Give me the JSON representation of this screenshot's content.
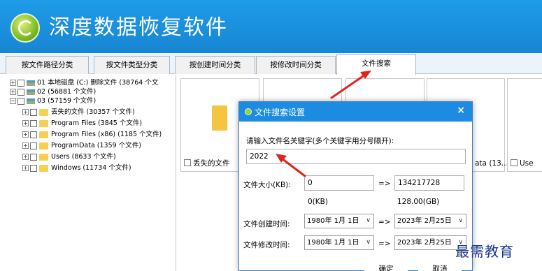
{
  "app": {
    "title": "深度数据恢复软件"
  },
  "tabs": [
    {
      "label": "按文件路径分类"
    },
    {
      "label": "按文件类型分类"
    },
    {
      "label": "按创建时间分类"
    },
    {
      "label": "按修改时间分类"
    },
    {
      "label": "文件搜索"
    }
  ],
  "tree": {
    "rows": [
      {
        "label": "01 本地磁盘 (C:) 删除文件 (38764 个文"
      },
      {
        "label": "02  (56881 个文件)"
      },
      {
        "label": "03  (57159 个文件)"
      },
      {
        "label": "丢失的文件    (30357 个文件)"
      },
      {
        "label": "Program Files    (3845 个文件)"
      },
      {
        "label": "Program Files (x86)    (1185 个文件)"
      },
      {
        "label": "ProgramData    (1359 个文件)"
      },
      {
        "label": "Users    (8633 个文件)"
      },
      {
        "label": "Windows    (11734 个文件)"
      }
    ]
  },
  "tiles": [
    {
      "label": "丢失的文件"
    },
    {
      "label": "ata (13..."
    },
    {
      "label": "Use"
    }
  ],
  "dialog": {
    "title": "文件搜索设置",
    "close": "×",
    "keyword_label": "请输入文件名关键字(多个关键字用分号隔开):",
    "keyword_value": "2022",
    "size_label": "文件大小(KB):",
    "size_min": "0",
    "size_max": "134217728",
    "size_min_unit": "0(KB)",
    "size_max_unit": "128.00(GB)",
    "arrow_sep": "=>",
    "created_label": "文件创建时间:",
    "modified_label": "文件修改时间:",
    "created_from": "1980年  1月  1日",
    "created_to": "2023年  2月25日",
    "modified_from": "1980年  1月  1日",
    "modified_to": "2023年  2月25日",
    "chevron": "∨",
    "ok": "确定",
    "cancel": "取消"
  },
  "watermark": "最需教育",
  "colors": {
    "header": "#1786d3",
    "dialog_title": "#1c8ce2",
    "annotation_arrow": "#e0241c",
    "folder": "#f5c542"
  }
}
